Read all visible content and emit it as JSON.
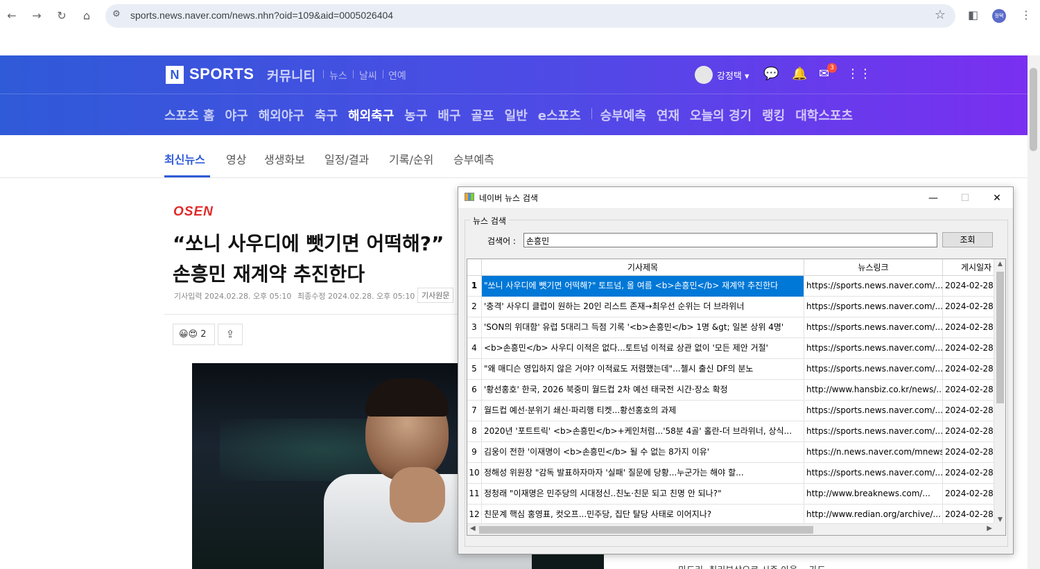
{
  "browser": {
    "url": "sports.news.naver.com/news.nhn?oid=109&aid=0005026404",
    "profile_label": "정택"
  },
  "header": {
    "logo_n": "N",
    "logo_text": "SPORTS",
    "community": "커뮤니티",
    "sub_services": [
      "뉴스",
      "날씨",
      "연예"
    ],
    "user_name": "강정택 ▾",
    "mail_badge": "3",
    "menu": [
      "스포츠 홈",
      "야구",
      "해외야구",
      "축구",
      "해외축구",
      "농구",
      "배구",
      "골프",
      "일반",
      "e스포츠"
    ],
    "menu2": [
      "승부예측",
      "연재",
      "오늘의 경기",
      "랭킹",
      "대학스포츠"
    ],
    "active_menu": "해외축구"
  },
  "subnav": {
    "items": [
      "최신뉴스",
      "영상",
      "생생화보",
      "일정/결과",
      "기록/순위",
      "승부예측"
    ]
  },
  "article": {
    "press": "OSEN",
    "headline_line1": "“쏘니 사우디에 뺏기면 어떡해?”",
    "headline_line2": "손흥민 재계약 추진한다",
    "input_time": "기사입력  2024.02.28. 오후 05:10",
    "modified_time": "최종수정  2024.02.28. 오후 05:10",
    "original_btn": "기사원문",
    "reaction_count": "2",
    "sidebar_snippet": "· 마드리, 취리부상으로 시즌 아웃 ...가도..."
  },
  "window": {
    "title": "네이버 뉴스 검색",
    "group_label": "뉴스 검색",
    "search_label": "검색어 :",
    "search_value": "손흥민",
    "search_button": "조회",
    "columns": [
      "",
      "기사제목",
      "뉴스링크",
      "게시일자"
    ],
    "rows": [
      {
        "n": "1",
        "title": "\"쏘니 사우디에 뺏기면 어떡해?\" 토트넘, 올 여름 <b>손흥민</b> 재계약 추진한다",
        "link": "https://sports.news.naver.com/...",
        "date": "2024-02-28"
      },
      {
        "n": "2",
        "title": "'충격' 사우디 클럽이 원하는 20인 리스트 존재→최우선 순위는 더 브라위너",
        "link": "https://sports.news.naver.com/...",
        "date": "2024-02-28"
      },
      {
        "n": "3",
        "title": "'SON의 위대함' 유럽 5대리그 득점 기록 '<b>손흥민</b> 1명 &gt; 일본 상위 4명'",
        "link": "https://sports.news.naver.com/...",
        "date": "2024-02-28"
      },
      {
        "n": "4",
        "title": "<b>손흥민</b> 사우디 이적은 없다...토트넘 이적료 상관 없이 '모든 제안 거절'",
        "link": "https://sports.news.naver.com/...",
        "date": "2024-02-28"
      },
      {
        "n": "5",
        "title": "\"왜 매디슨 영입하지 않은 거야? 이적료도 저렴했는데\"...첼시 출신 DF의 분노",
        "link": "https://sports.news.naver.com/...",
        "date": "2024-02-28"
      },
      {
        "n": "6",
        "title": "'황선홍호' 한국, 2026 북중미 월드컵 2차 예선 태국전 시간·장소 확정",
        "link": "http://www.hansbiz.co.kr/news/...",
        "date": "2024-02-28"
      },
      {
        "n": "7",
        "title": "월드컵 예선·분위기 쇄신·파리행 티켓...황선홍호의 과제",
        "link": "https://sports.news.naver.com/...",
        "date": "2024-02-28"
      },
      {
        "n": "8",
        "title": "2020년 '포트트릭' <b>손흥민</b>+케인처럼...'58분 4골' 홀란-더 브라위너, 상식...",
        "link": "https://sports.news.naver.com/...",
        "date": "2024-02-28"
      },
      {
        "n": "9",
        "title": "김웅이 전한 '이재명이 <b>손흥민</b> 될 수 없는 8가지 이유'",
        "link": "https://n.news.naver.com/mnews/...",
        "date": "2024-02-28"
      },
      {
        "n": "10",
        "title": "정해성 위원장 \"감독 발표하자마자 '실패' 질문에 당황...누군가는 해야 할...",
        "link": "https://sports.news.naver.com/...",
        "date": "2024-02-28"
      },
      {
        "n": "11",
        "title": "정청래 \"이재명은 민주당의 시대정신..친노·친문 되고 친명 안 되나?\"",
        "link": "http://www.breaknews.com/...",
        "date": "2024-02-28"
      },
      {
        "n": "12",
        "title": "친문계 핵심 홍영표, 컷오프...민주당, 집단 탈당 사태로 이어지나?",
        "link": "http://www.redian.org/archive/...",
        "date": "2024-02-28"
      }
    ]
  }
}
